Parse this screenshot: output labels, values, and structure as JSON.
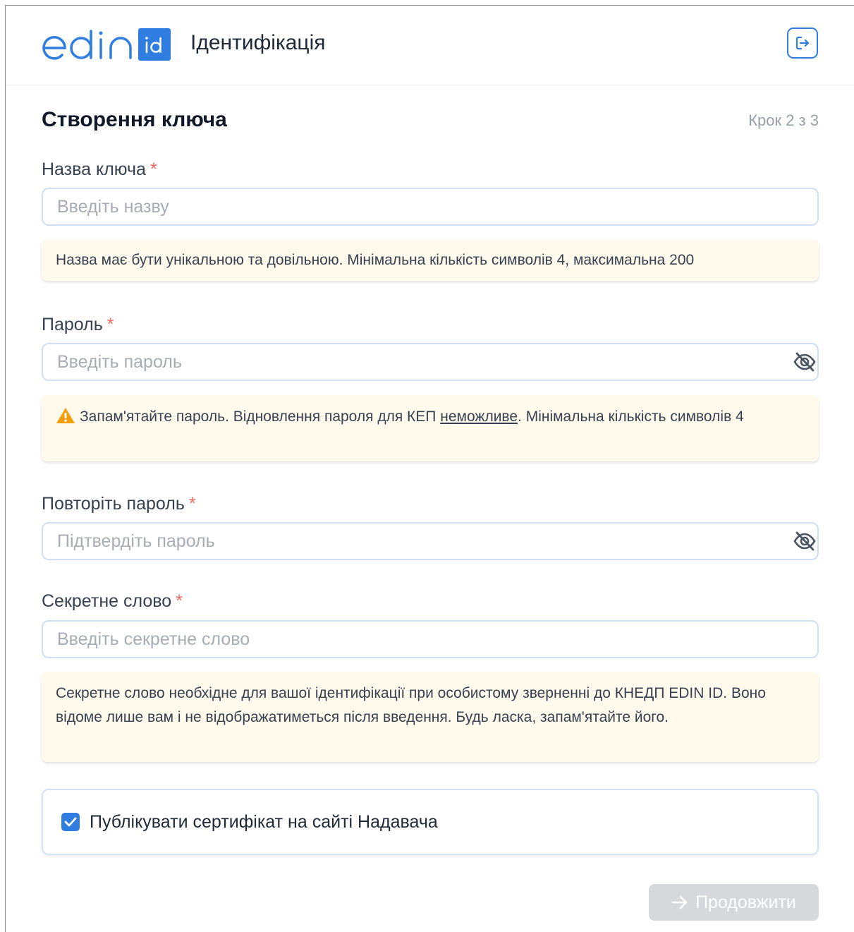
{
  "header": {
    "logo_text": "edin",
    "logo_badge": "id",
    "title": "Ідентифікація",
    "logout_icon": "logout-icon",
    "accent_color": "#2f7de1"
  },
  "page": {
    "title": "Створення ключа",
    "step": "Крок 2 з 3"
  },
  "form": {
    "key_name": {
      "label": "Назва ключа",
      "required": "*",
      "placeholder": "Введіть назву",
      "hint": "Назва має бути унікальною та довільною. Мінімальна кількість символів 4, максимальна 200"
    },
    "password": {
      "label": "Пароль",
      "required": "*",
      "placeholder": "Введіть пароль",
      "hint_part1": "Запам'ятайте пароль. Відновлення пароля для КЕП ",
      "hint_underlined": "неможливе",
      "hint_part2": ". Мінімальна кількість символів 4"
    },
    "password_repeat": {
      "label": "Повторіть пароль",
      "required": "*",
      "placeholder": "Підтвердіть пароль"
    },
    "secret_word": {
      "label": "Секретне слово",
      "required": "*",
      "placeholder": "Введіть секретне слово",
      "hint": "Секретне слово необхідне для вашої ідентифікації при особистому зверненні до КНЕДП EDIN ID. Воно відоме лише вам і не відображатиметься після введення. Будь ласка, запам'ятайте його."
    },
    "publish_checkbox": {
      "label": "Публікувати сертифікат на сайті Надавача",
      "checked": true
    }
  },
  "actions": {
    "continue_label": "Продовжити"
  }
}
